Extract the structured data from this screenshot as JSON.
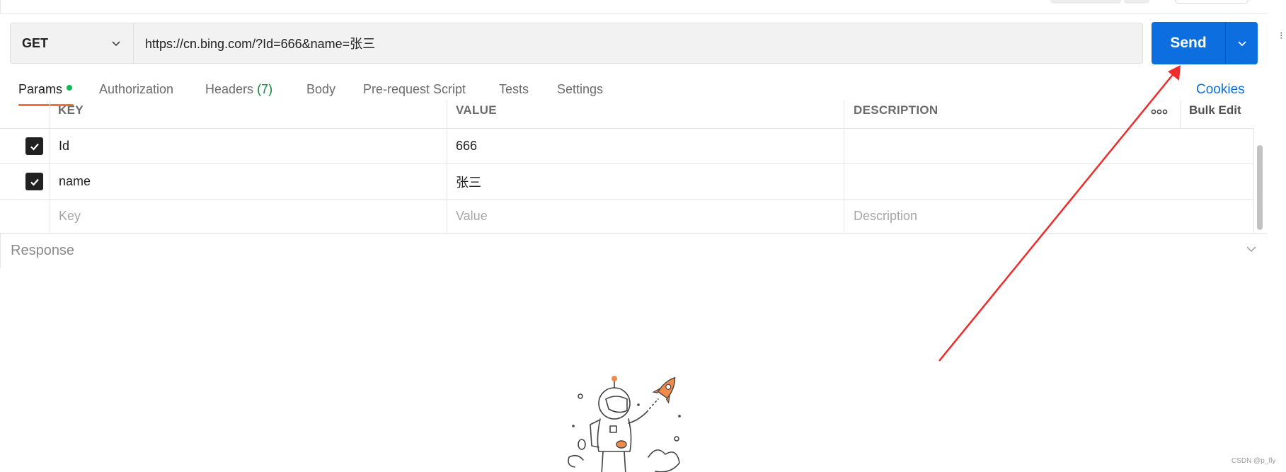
{
  "request": {
    "method": "GET",
    "url": "https://cn.bing.com/?Id=666&name=张三",
    "send_label": "Send"
  },
  "side_glyph": "⁝",
  "tabs": [
    {
      "label": "Params",
      "active": true,
      "dot": true
    },
    {
      "label": "Authorization"
    },
    {
      "label": "Headers",
      "count": "(7)"
    },
    {
      "label": "Body"
    },
    {
      "label": "Pre-request Script"
    },
    {
      "label": "Tests"
    },
    {
      "label": "Settings"
    }
  ],
  "cookies_label": "Cookies",
  "params_table": {
    "headers": {
      "key": "KEY",
      "value": "VALUE",
      "description": "DESCRIPTION",
      "bulk_edit": "Bulk Edit"
    },
    "rows": [
      {
        "checked": true,
        "key": "Id",
        "value": "666",
        "description": ""
      },
      {
        "checked": true,
        "key": "name",
        "value": "张三",
        "description": ""
      }
    ],
    "placeholders": {
      "key": "Key",
      "value": "Value",
      "description": "Description"
    }
  },
  "response": {
    "title": "Response"
  },
  "watermark": "CSDN @p_fly",
  "colors": {
    "send": "#0c6edf",
    "tab_active_underline": "#ff6c37",
    "params_dot": "#0cbb52",
    "annotation_arrow": "#ee2c2c"
  }
}
